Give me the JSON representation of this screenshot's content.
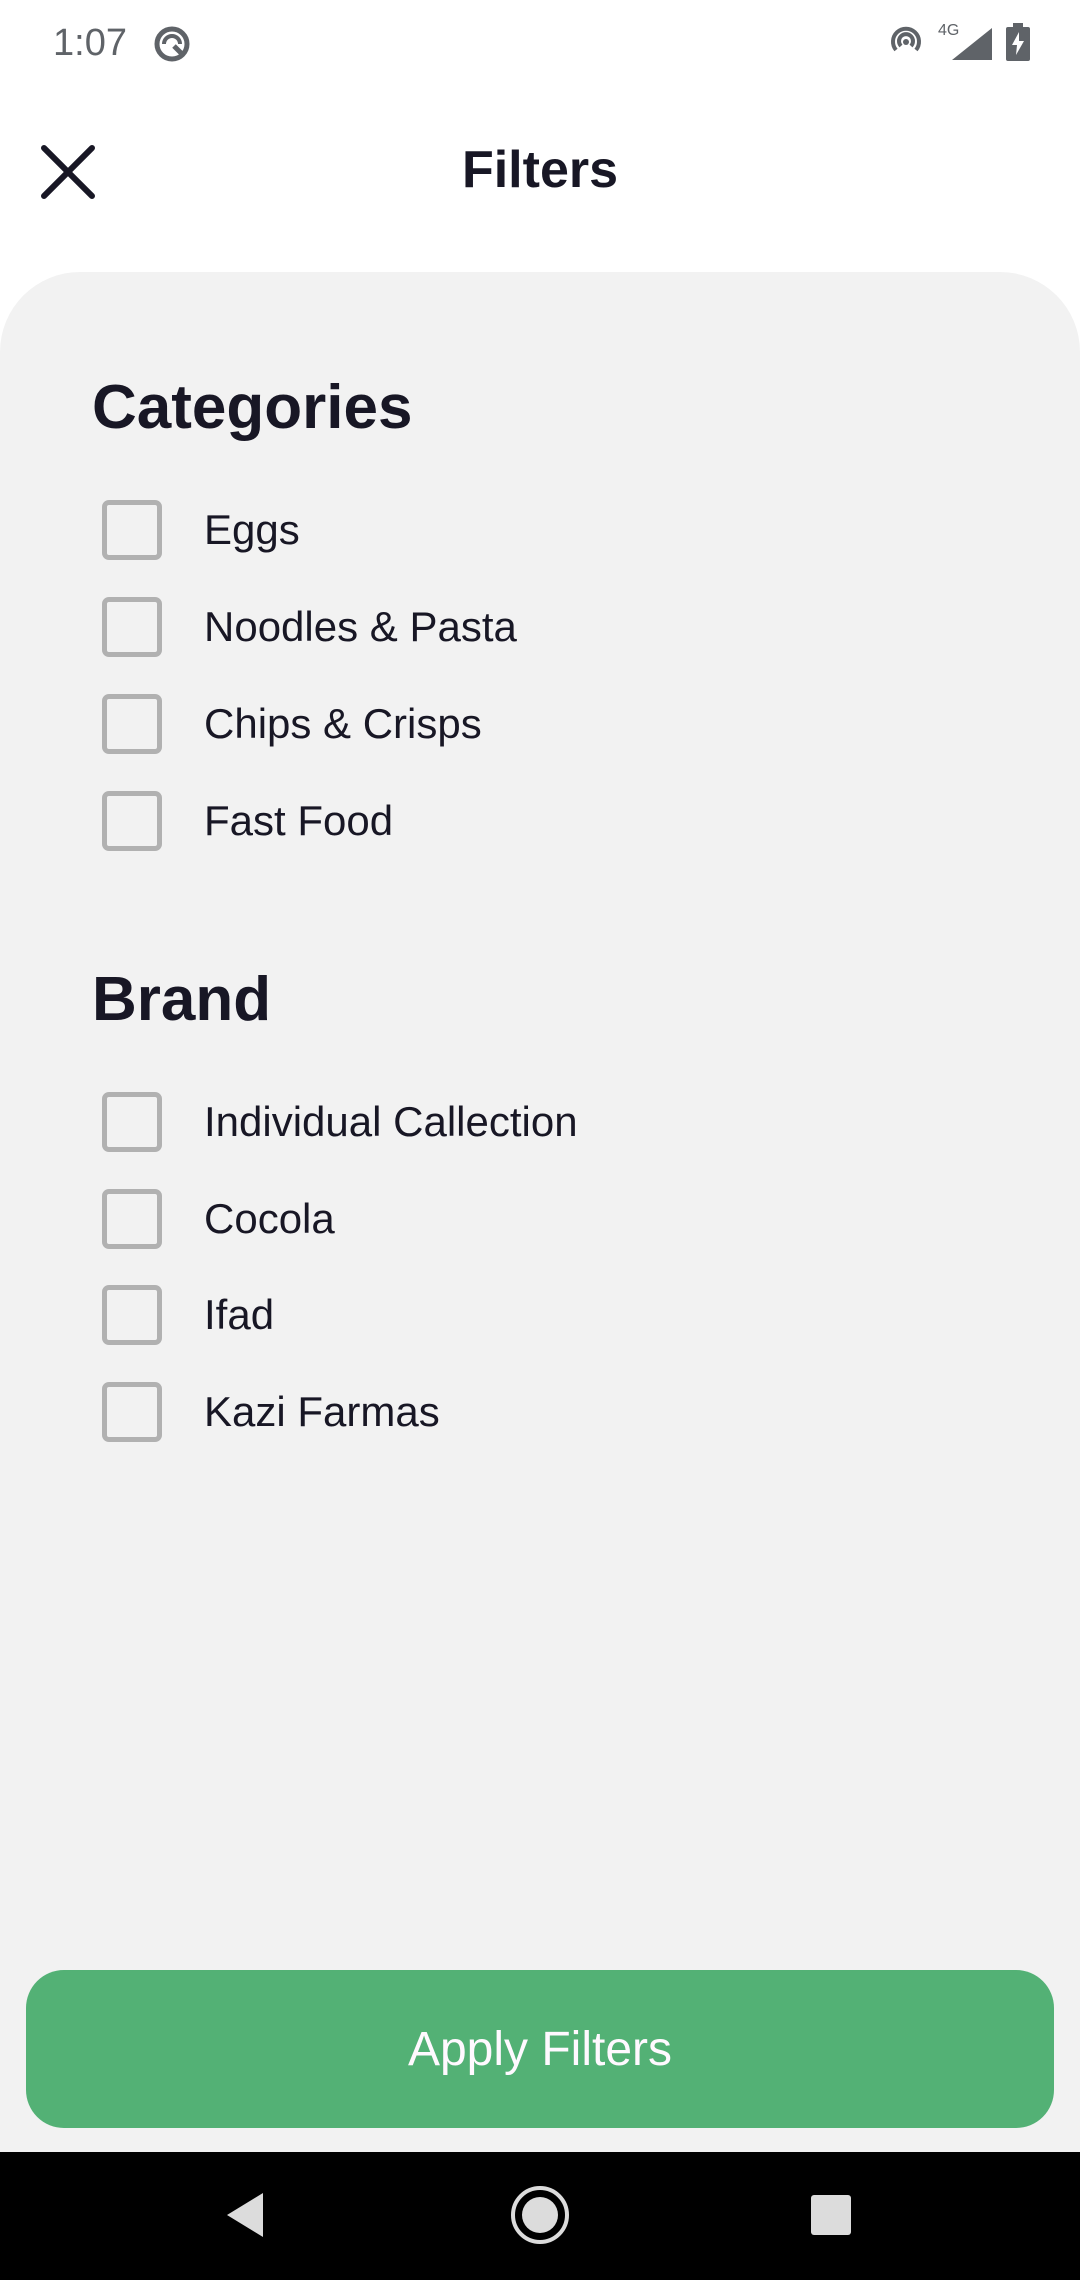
{
  "status_bar": {
    "time": "1:07",
    "left_icon": "do-not-disturb-icon",
    "right_icons": [
      "hotspot-icon",
      "signal-4g-icon",
      "battery-charging-icon"
    ],
    "network_label": "4G"
  },
  "header": {
    "title": "Filters",
    "close_icon": "close-icon"
  },
  "categories": {
    "title": "Categories",
    "items": [
      {
        "label": "Eggs",
        "checked": false
      },
      {
        "label": "Noodles & Pasta",
        "checked": false
      },
      {
        "label": "Chips & Crisps",
        "checked": false
      },
      {
        "label": "Fast Food",
        "checked": false
      }
    ]
  },
  "brand": {
    "title": "Brand",
    "items": [
      {
        "label": "Individual Callection",
        "checked": false
      },
      {
        "label": "Cocola",
        "checked": false
      },
      {
        "label": "Ifad",
        "checked": false
      },
      {
        "label": "Kazi Farmas",
        "checked": false
      }
    ]
  },
  "apply_button": {
    "label": "Apply Filters"
  },
  "nav_bar": {
    "icons": [
      "back-icon",
      "home-icon",
      "recents-icon"
    ]
  },
  "colors": {
    "accent": "#53b175",
    "sheet_bg": "#f2f2f2",
    "text": "#181725",
    "checkbox_border": "#b1b1b1",
    "nav_bg": "#000000"
  }
}
